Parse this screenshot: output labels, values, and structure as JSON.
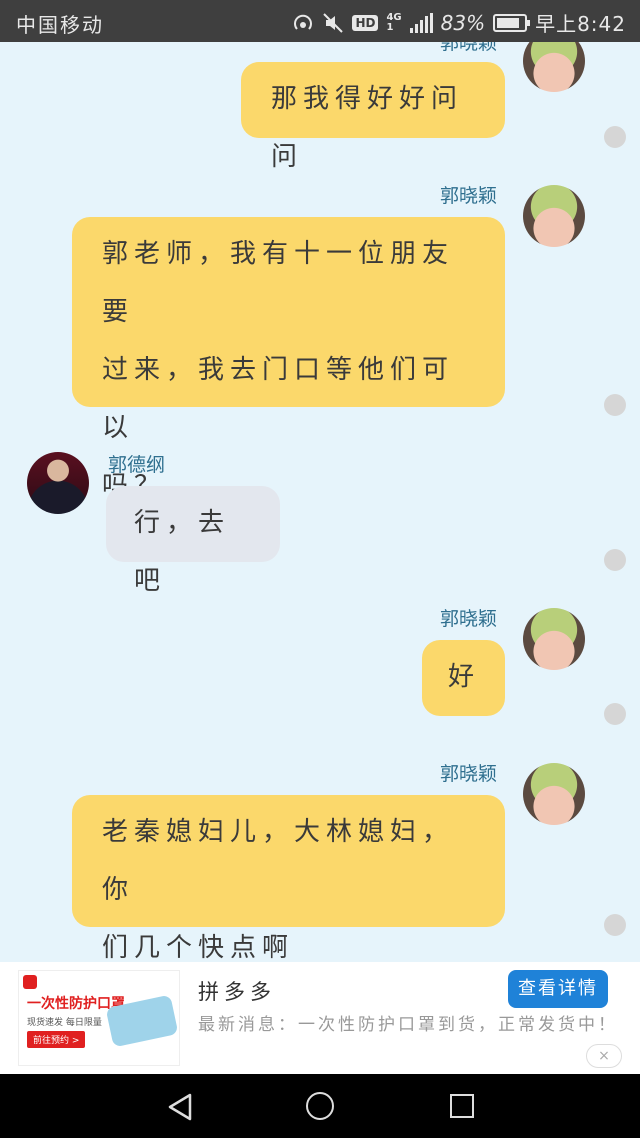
{
  "status_bar": {
    "carrier": "中国移动",
    "hd": "HD",
    "network_top": "4G",
    "network_bottom": "1",
    "battery": "83%",
    "battery_level": 0.83,
    "time": "早上8:42"
  },
  "chat": {
    "top_partial_name": "郭晓颖",
    "messages": [
      {
        "sender": "郭晓颖",
        "side": "right",
        "text_lines": [
          "那我得好好问问"
        ],
        "show_name": false
      },
      {
        "sender": "郭晓颖",
        "side": "right",
        "text_lines": [
          "郭老师，我有十一位朋友要",
          "过来，我去门口等他们可以",
          "吗？"
        ]
      },
      {
        "sender": "郭德纲",
        "side": "left",
        "text_lines": [
          "行，去吧"
        ]
      },
      {
        "sender": "郭晓颖",
        "side": "right",
        "text_lines": [
          "好"
        ]
      },
      {
        "sender": "郭晓颖",
        "side": "right",
        "text_lines": [
          "老秦媳妇儿，大林媳妇，你",
          "们几个快点啊"
        ]
      }
    ]
  },
  "ad": {
    "image": {
      "title": "一次性防护口罩",
      "sub": "现货速发 每日限量",
      "cta": "前往预约 >"
    },
    "name": "拼多多",
    "message": "最新消息：一次性防护口罩到货，正常发货中！",
    "button": "查看详情",
    "close": "×"
  },
  "colors": {
    "background": "#e6f4fb",
    "my_bubble": "#fbd86b",
    "their_bubble": "#e3e7ee",
    "name_text": "#2f6f8f",
    "ad_button": "#1f82d8"
  }
}
